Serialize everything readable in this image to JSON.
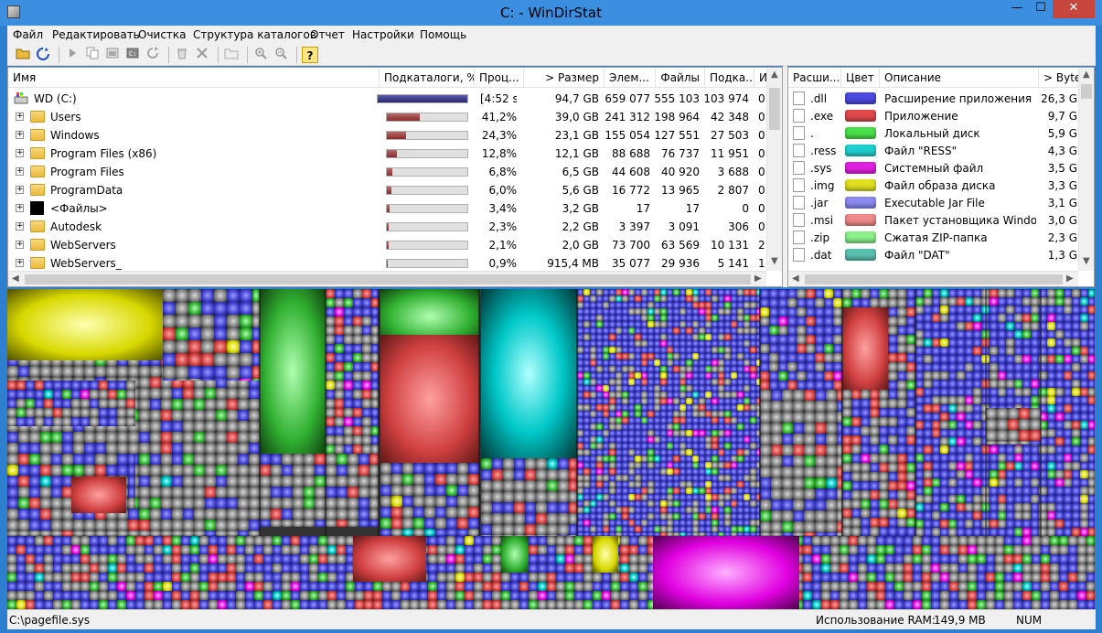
{
  "window": {
    "title": "C: - WinDirStat",
    "controls": {
      "minimize": "—",
      "maximize": "☐",
      "close": "✕"
    }
  },
  "menu": [
    "Файл",
    "Редактировать",
    "Очистка",
    "Структура каталогов",
    "Отчет",
    "Настройки",
    "Помощь"
  ],
  "toolbar": {
    "icons": [
      "open-icon",
      "refresh-icon",
      "play-icon",
      "copy-icon",
      "explorer-icon",
      "cmd-icon",
      "refresh-selected-icon",
      "recycle-icon",
      "delete-icon",
      "folder-props-icon",
      "zoom-in-icon",
      "zoom-out-icon",
      "help-icon"
    ],
    "help_glyph": "?"
  },
  "dir_tree": {
    "columns": [
      "Имя",
      "Подкаталоги, %",
      "Проц...",
      "> Размер",
      "Элем...",
      "Файлы",
      "Подка...",
      "И"
    ],
    "rows": [
      {
        "name": "WD (C:)",
        "type": "drive",
        "bar": 1.0,
        "bar_color": "blue",
        "percent": "[4:52 s]",
        "size": "94,7 GB",
        "items": "659 077",
        "files": "555 103",
        "subdirs": "103 974",
        "last": "0"
      },
      {
        "name": "Users",
        "type": "folder",
        "bar": 0.412,
        "percent": "41,2%",
        "size": "39,0 GB",
        "items": "241 312",
        "files": "198 964",
        "subdirs": "42 348",
        "last": "0"
      },
      {
        "name": "Windows",
        "type": "folder",
        "bar": 0.243,
        "percent": "24,3%",
        "size": "23,1 GB",
        "items": "155 054",
        "files": "127 551",
        "subdirs": "27 503",
        "last": "0"
      },
      {
        "name": "Program Files (x86)",
        "type": "folder",
        "bar": 0.128,
        "percent": "12,8%",
        "size": "12,1 GB",
        "items": "88 688",
        "files": "76 737",
        "subdirs": "11 951",
        "last": "0"
      },
      {
        "name": "Program Files",
        "type": "folder",
        "bar": 0.068,
        "percent": "6,8%",
        "size": "6,5 GB",
        "items": "44 608",
        "files": "40 920",
        "subdirs": "3 688",
        "last": "0"
      },
      {
        "name": "ProgramData",
        "type": "folder",
        "bar": 0.06,
        "percent": "6,0%",
        "size": "5,6 GB",
        "items": "16 772",
        "files": "13 965",
        "subdirs": "2 807",
        "last": "0"
      },
      {
        "name": "<Файлы>",
        "type": "files",
        "bar": 0.034,
        "percent": "3,4%",
        "size": "3,2 GB",
        "items": "17",
        "files": "17",
        "subdirs": "0",
        "last": "0"
      },
      {
        "name": "Autodesk",
        "type": "folder",
        "bar": 0.023,
        "percent": "2,3%",
        "size": "2,2 GB",
        "items": "3 397",
        "files": "3 091",
        "subdirs": "306",
        "last": "0"
      },
      {
        "name": "WebServers",
        "type": "folder",
        "bar": 0.021,
        "percent": "2,1%",
        "size": "2,0 GB",
        "items": "73 700",
        "files": "63 569",
        "subdirs": "10 131",
        "last": "2"
      },
      {
        "name": "WebServers_",
        "type": "folder",
        "bar": 0.009,
        "percent": "0,9%",
        "size": "915,4 MB",
        "items": "35 077",
        "files": "29 936",
        "subdirs": "5 141",
        "last": "1"
      }
    ]
  },
  "ext_list": {
    "columns": [
      "Расши...",
      "Цвет",
      "Описание",
      "> Byte"
    ],
    "rows": [
      {
        "ext": ".dll",
        "color": "#4a4ae0",
        "desc": "Расширение приложения",
        "bytes": "26,3 G"
      },
      {
        "ext": ".exe",
        "color": "#e04a4a",
        "desc": "Приложение",
        "bytes": "9,7 G"
      },
      {
        "ext": ".",
        "color": "#4ae04a",
        "desc": "Локальный диск",
        "bytes": "5,9 G"
      },
      {
        "ext": ".ress",
        "color": "#20d0d0",
        "desc": "Файл \"RESS\"",
        "bytes": "4,3 G"
      },
      {
        "ext": ".sys",
        "color": "#e020e0",
        "desc": "Системный файл",
        "bytes": "3,5 G"
      },
      {
        "ext": ".img",
        "color": "#e0e020",
        "desc": "Файл образа диска",
        "bytes": "3,3 G"
      },
      {
        "ext": ".jar",
        "color": "#8a8af0",
        "desc": "Executable Jar File",
        "bytes": "3,1 G"
      },
      {
        "ext": ".msi",
        "color": "#f08a8a",
        "desc": "Пакет установщика Windo...",
        "bytes": "3,0 G"
      },
      {
        "ext": ".zip",
        "color": "#8af08a",
        "desc": "Сжатая ZIP-папка",
        "bytes": "2,3 G"
      },
      {
        "ext": ".dat",
        "color": "#5ac0b0",
        "desc": "Файл \"DAT\"",
        "bytes": "1,3 G"
      }
    ]
  },
  "status": {
    "path": "C:\\pagefile.sys",
    "ram_label": "Использование RAM:",
    "ram_value": "149,9 MB",
    "num": "NUM"
  },
  "treemap_colors": [
    "#4a4ae0",
    "#e04a4a",
    "#4ae04a",
    "#20d0d0",
    "#e020e0",
    "#e0e020",
    "#888888"
  ]
}
